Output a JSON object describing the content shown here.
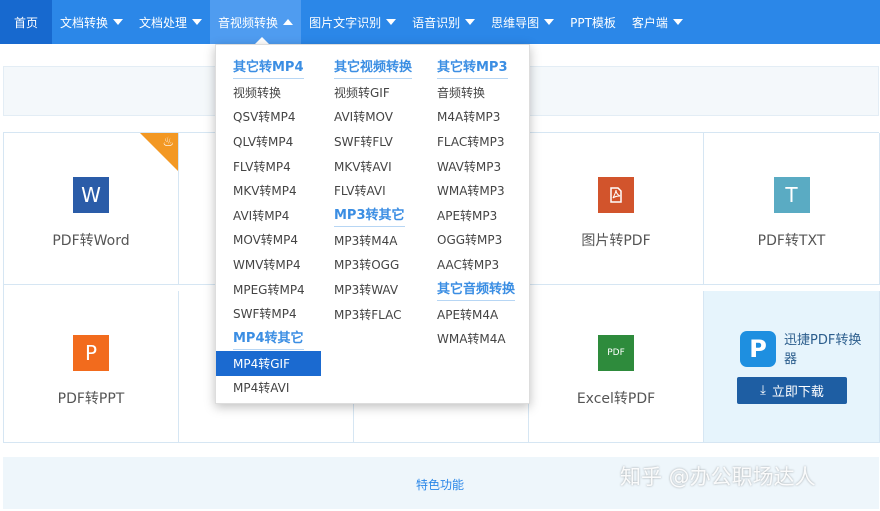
{
  "nav": {
    "items": [
      {
        "label": "首页",
        "caret": false
      },
      {
        "label": "文档转换",
        "caret": true
      },
      {
        "label": "文档处理",
        "caret": true
      },
      {
        "label": "音视频转换",
        "caret": true
      },
      {
        "label": "图片文字识别",
        "caret": true
      },
      {
        "label": "语音识别",
        "caret": true
      },
      {
        "label": "思维导图",
        "caret": true
      },
      {
        "label": "PPT模板",
        "caret": false
      },
      {
        "label": "客户端",
        "caret": true
      }
    ]
  },
  "dropdown": {
    "col1": {
      "header1": "其它转MP4",
      "items1": [
        "视频转换",
        "QSV转MP4",
        "QLV转MP4",
        "FLV转MP4",
        "MKV转MP4",
        "AVI转MP4",
        "MOV转MP4",
        "WMV转MP4",
        "MPEG转MP4",
        "SWF转MP4"
      ],
      "header2": "MP4转其它",
      "items2": [
        "MP4转GIF",
        "MP4转AVI"
      ],
      "active": "MP4转GIF"
    },
    "col2": {
      "header1": "其它视频转换",
      "items1": [
        "视频转GIF",
        "AVI转MOV",
        "SWF转FLV",
        "MKV转AVI",
        "FLV转AVI"
      ],
      "header2": "MP3转其它",
      "items2": [
        "MP3转M4A",
        "MP3转OGG",
        "MP3转WAV",
        "MP3转FLAC"
      ]
    },
    "col3": {
      "header1": "其它转MP3",
      "items1": [
        "音频转换",
        "M4A转MP3",
        "FLAC转MP3",
        "WAV转MP3",
        "WMA转MP3",
        "APE转MP3",
        "OGG转MP3",
        "AAC转MP3"
      ],
      "header2": "其它音频转换",
      "items2": [
        "APE转M4A",
        "WMA转M4A"
      ]
    }
  },
  "tools": {
    "pdf_to_word": {
      "label": "PDF转Word",
      "icon": "W",
      "color": "#2a5ca8"
    },
    "image_to_pdf": {
      "label": "图片转PDF",
      "icon": "pdf-icon",
      "color": "#d2542c"
    },
    "pdf_to_txt": {
      "label": "PDF转TXT",
      "icon": "T",
      "color": "#5aabc3"
    },
    "pdf_to_ppt": {
      "label": "PDF转PPT",
      "icon": "P",
      "color": "#f26b1d"
    },
    "excel_to_pdf": {
      "label": "Excel转PDF",
      "icon": "PDF",
      "color": "#2e8b3c"
    }
  },
  "promo": {
    "title": "迅捷PDF转换器",
    "download": "立即下载"
  },
  "bottom": {
    "text": "特色功能"
  },
  "watermark": "知乎 @办公职场达人"
}
